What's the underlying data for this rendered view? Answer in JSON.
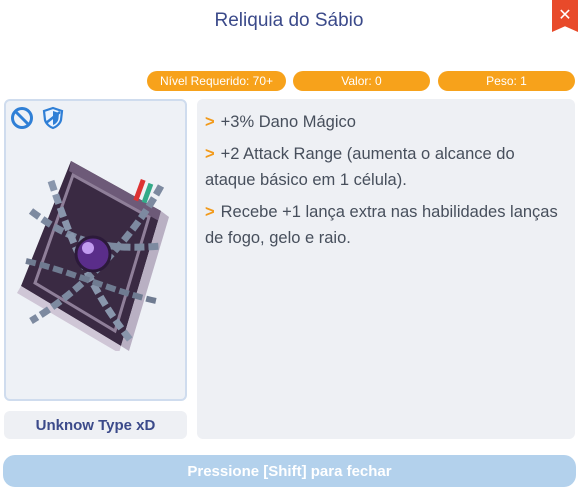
{
  "window": {
    "title": "Reliquia do Sábio"
  },
  "stats": {
    "required_level": "Nível Requerido: 70+",
    "value": "Valor: 0",
    "weight": "Peso: 1"
  },
  "item": {
    "type": "Unknow Type xD",
    "icons": [
      "no-trade-icon",
      "shield-icon"
    ],
    "art": "chained-spellbook-icon"
  },
  "description": [
    {
      "bullet": ">",
      "text": "+3% Dano Mágico"
    },
    {
      "bullet": ">",
      "text": "+2 Attack Range (aumenta o alcance do ataque básico em 1 célula)."
    },
    {
      "bullet": ">",
      "text": "Recebe +1 lança extra nas habilidades lanças de fogo, gelo e raio."
    }
  ],
  "footer": {
    "close_hint": "Pressione [Shift] para fechar"
  },
  "colors": {
    "accent": "#f7a21b",
    "title": "#3b4a8a",
    "close": "#e84a2a",
    "panel": "#eef0f4",
    "footer": "#b3d1ec"
  }
}
